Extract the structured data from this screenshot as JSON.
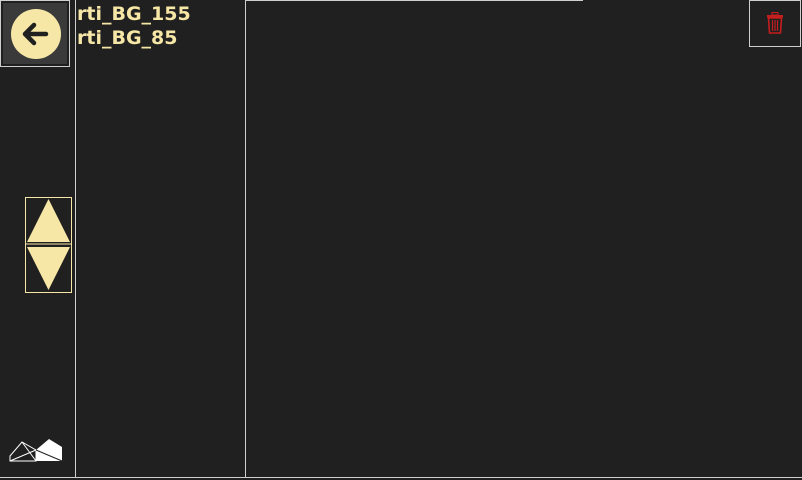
{
  "toolbar": {
    "back_icon": "arrow-left-icon",
    "scroll_up_icon": "triangle-up-icon",
    "scroll_down_icon": "triangle-down-icon",
    "logo_icon": "logo-icon"
  },
  "file_list": {
    "items": [
      {
        "label": "rti_BG_155"
      },
      {
        "label": "rti_BG_85"
      }
    ]
  },
  "actions": {
    "delete_icon": "trash-icon"
  },
  "colors": {
    "background": "#202020",
    "accent": "#f7e7a6",
    "divider": "#cfcfcf",
    "delete": "#c41e1e"
  }
}
